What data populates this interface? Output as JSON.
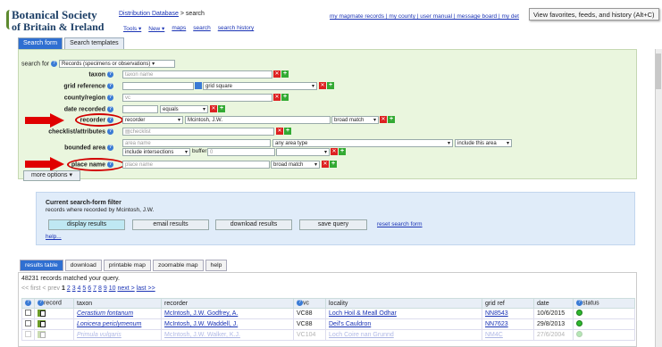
{
  "logo": {
    "line1": "Botanical Society",
    "line2": "of Britain & Ireland"
  },
  "breadcrumb": {
    "link": "Distribution Database",
    "sep": " > ",
    "current": "search"
  },
  "toolbar": {
    "tools": "Tools ▾",
    "new": "New ▾",
    "maps": "maps",
    "search": "search",
    "history": "search history"
  },
  "toplinks": "my mapmate records | my county | user manual | message board | my det",
  "tooltip": "View favorites, feeds, and history (Alt+C)",
  "tabs": {
    "form": "Search form",
    "templates": "Search templates"
  },
  "form": {
    "search_for_label": "search for",
    "search_for_value": "Records (specimens or observations)",
    "taxon_label": "taxon",
    "taxon_placeholder": "taxon name",
    "grid_label": "grid reference",
    "grid_placeholder": "grid square",
    "county_label": "county/region",
    "county_placeholder": "vc",
    "date_label": "date recorded",
    "date_mode": "equals",
    "recorder_label": "recorder",
    "recorder_field": "recorder",
    "recorder_value": "Mcintosh, J.W.",
    "recorder_match": "broad match",
    "checklist_label": "checklist/attributes",
    "checklist_placeholder": "checklist",
    "bounded_label": "bounded area",
    "area_placeholder": "area name",
    "area_type": "any area type",
    "area_include": "include this area",
    "intersect": "include intersections",
    "buffer_label": "buffer",
    "buffer_value": "0",
    "place_label": "place name",
    "place_placeholder": "place name",
    "place_match": "broad match",
    "more_options": "more options ▾"
  },
  "filter": {
    "title": "Current search-form filter",
    "desc": "records where recorded by Mcintosh, J.W.",
    "display": "display results",
    "email": "email results",
    "download": "download results",
    "save": "save query",
    "reset": "reset search form",
    "help": "help..."
  },
  "results_tabs": [
    "results table",
    "download",
    "printable map",
    "zoomable map",
    "help"
  ],
  "results": {
    "count": "48231 records matched your query.",
    "pager_first": "<< first",
    "pager_prev": "< prev",
    "pages": [
      "1",
      "2",
      "3",
      "4",
      "5",
      "6",
      "7",
      "8",
      "9",
      "10"
    ],
    "next": "next >",
    "last": "last >>",
    "columns": [
      "record",
      "taxon",
      "recorder",
      "vc",
      "locality",
      "grid ref",
      "date",
      "status"
    ],
    "rows": [
      {
        "taxon": "Cerastium fontanum",
        "recorder": "McIntosh, J.W. Godfrey, A.",
        "vc": "VC88",
        "locality": "Loch Hoil & Meall Odhar",
        "grid": "NN8543",
        "date": "10/6/2015"
      },
      {
        "taxon": "Lonicera periclymenum",
        "recorder": "McIntosh, J.W. Waddell, J.",
        "vc": "VC88",
        "locality": "Deil's Cauldron",
        "grid": "NN7623",
        "date": "29/8/2013"
      },
      {
        "taxon": "Primula vulgaris",
        "recorder": "McIntosh, J.W. Walker, K.J.",
        "vc": "VC104",
        "locality": "Loch Coire nan Grunnd",
        "grid": "NM4C",
        "date": "27/6/2004"
      }
    ]
  },
  "colors": {
    "accent": "#2f6fd1",
    "form_bg": "#eaf6de",
    "filter_bg": "#e0ecf9",
    "arrow": "#e00000",
    "link": "#1a33b5"
  }
}
